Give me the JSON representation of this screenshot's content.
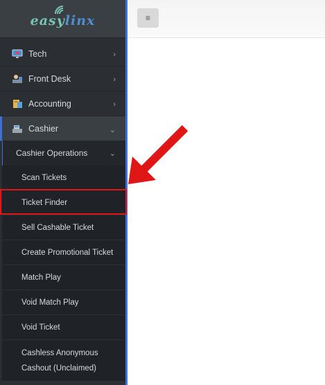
{
  "logo": {
    "part1": "easy",
    "part2": "linx"
  },
  "sidebar": {
    "items": [
      {
        "label": "Tech",
        "icon": "monitor-icon"
      },
      {
        "label": "Front Desk",
        "icon": "desk-icon"
      },
      {
        "label": "Accounting",
        "icon": "ledger-icon"
      },
      {
        "label": "Cashier",
        "icon": "register-icon"
      }
    ],
    "cashier_operations": {
      "label": "Cashier Operations",
      "items": [
        {
          "label": "Scan Tickets"
        },
        {
          "label": "Ticket Finder"
        },
        {
          "label": "Sell Cashable Ticket"
        },
        {
          "label": "Create Promotional Ticket"
        },
        {
          "label": "Match Play"
        },
        {
          "label": "Void Match Play"
        },
        {
          "label": "Void Ticket"
        },
        {
          "label": "Cashless Anonymous Cashout (Unclaimed)"
        }
      ]
    }
  },
  "topbar": {
    "menu_glyph": "≡"
  },
  "colors": {
    "sidebar_bg": "#2b2f34",
    "sidebar_accent": "#3f6fd1",
    "highlight": "#e01616",
    "arrow": "#e01616"
  }
}
